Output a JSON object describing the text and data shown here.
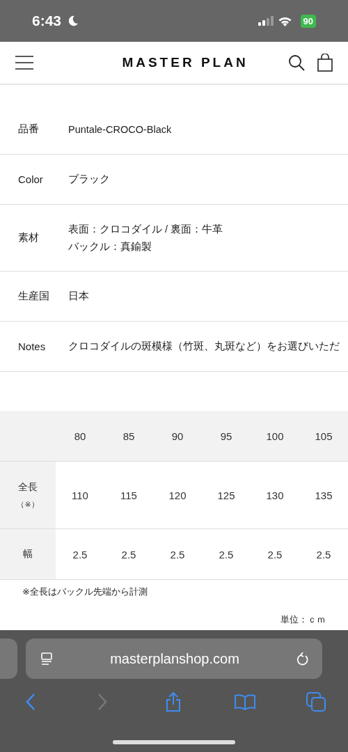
{
  "status_bar": {
    "time": "6:43",
    "battery": "90"
  },
  "header": {
    "logo": "MASTER PLAN"
  },
  "specs": [
    {
      "label": "品番",
      "lines": [
        "Puntale-CROCO-Black"
      ]
    },
    {
      "label": "Color",
      "lines": [
        "ブラック"
      ]
    },
    {
      "label": "素材",
      "lines": [
        "表面：クロコダイル / 裏面：牛革",
        "バックル：真鍮製"
      ]
    },
    {
      "label": "生産国",
      "lines": [
        "日本"
      ]
    },
    {
      "label": "Notes",
      "lines": [
        "クロコダイルの斑模様（竹斑、丸斑など）をお選びいただ"
      ]
    }
  ],
  "size_table": {
    "columns": [
      "80",
      "85",
      "90",
      "95",
      "100",
      "105"
    ],
    "rows": [
      {
        "label": "全長",
        "sub": "（※）",
        "values": [
          "110",
          "115",
          "120",
          "125",
          "130",
          "135"
        ]
      },
      {
        "label": "幅",
        "values": [
          "2.5",
          "2.5",
          "2.5",
          "2.5",
          "2.5",
          "2.5"
        ]
      }
    ]
  },
  "note": "※全長はバックル先端から計測",
  "unit": "単位：ｃｍ",
  "browser": {
    "url": "masterplanshop.com",
    "buttons": [
      {
        "kind": "back",
        "disabled": false
      },
      {
        "kind": "forward",
        "disabled": true
      },
      {
        "kind": "share",
        "disabled": false
      },
      {
        "kind": "bookmarks",
        "disabled": false
      },
      {
        "kind": "tabs",
        "disabled": false
      }
    ]
  }
}
